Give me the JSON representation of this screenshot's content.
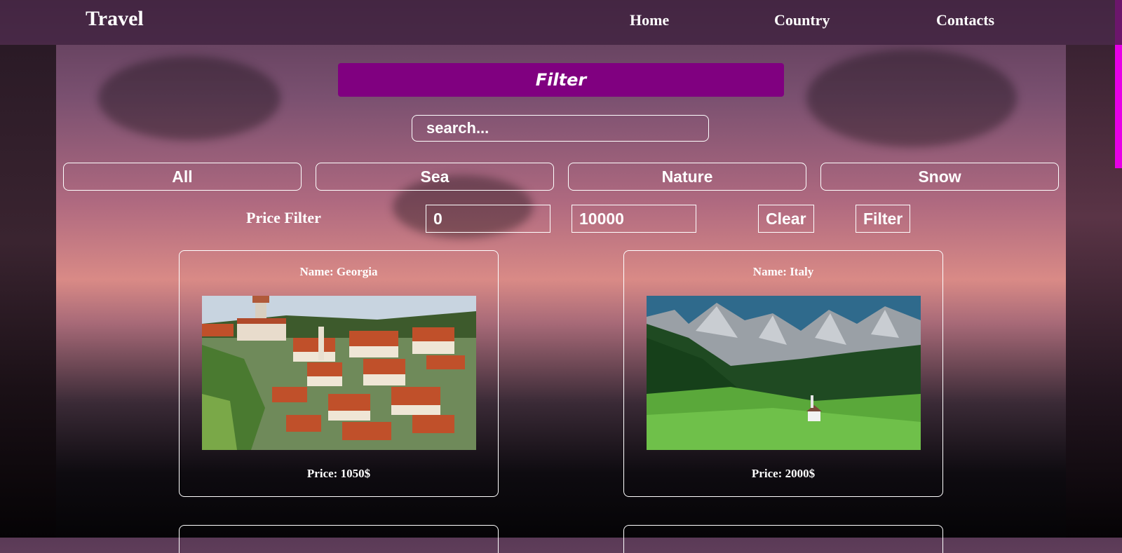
{
  "header": {
    "logo": "Travel",
    "nav": [
      "Home",
      "Country",
      "Contacts"
    ]
  },
  "filter": {
    "title": "Filter",
    "search_placeholder": "search...",
    "categories": [
      "All",
      "Sea",
      "Nature",
      "Snow"
    ],
    "price_label": "Price Filter",
    "min_price": "0",
    "max_price": "10000",
    "clear_label": "Clear",
    "filter_label": "Filter"
  },
  "cards": [
    {
      "name": "Name: Georgia",
      "price": "Price: 1050$"
    },
    {
      "name": "Name: Italy",
      "price": "Price: 2000$"
    }
  ],
  "colors": {
    "accent": "#800080",
    "scroll_accent": "#e600e6"
  }
}
